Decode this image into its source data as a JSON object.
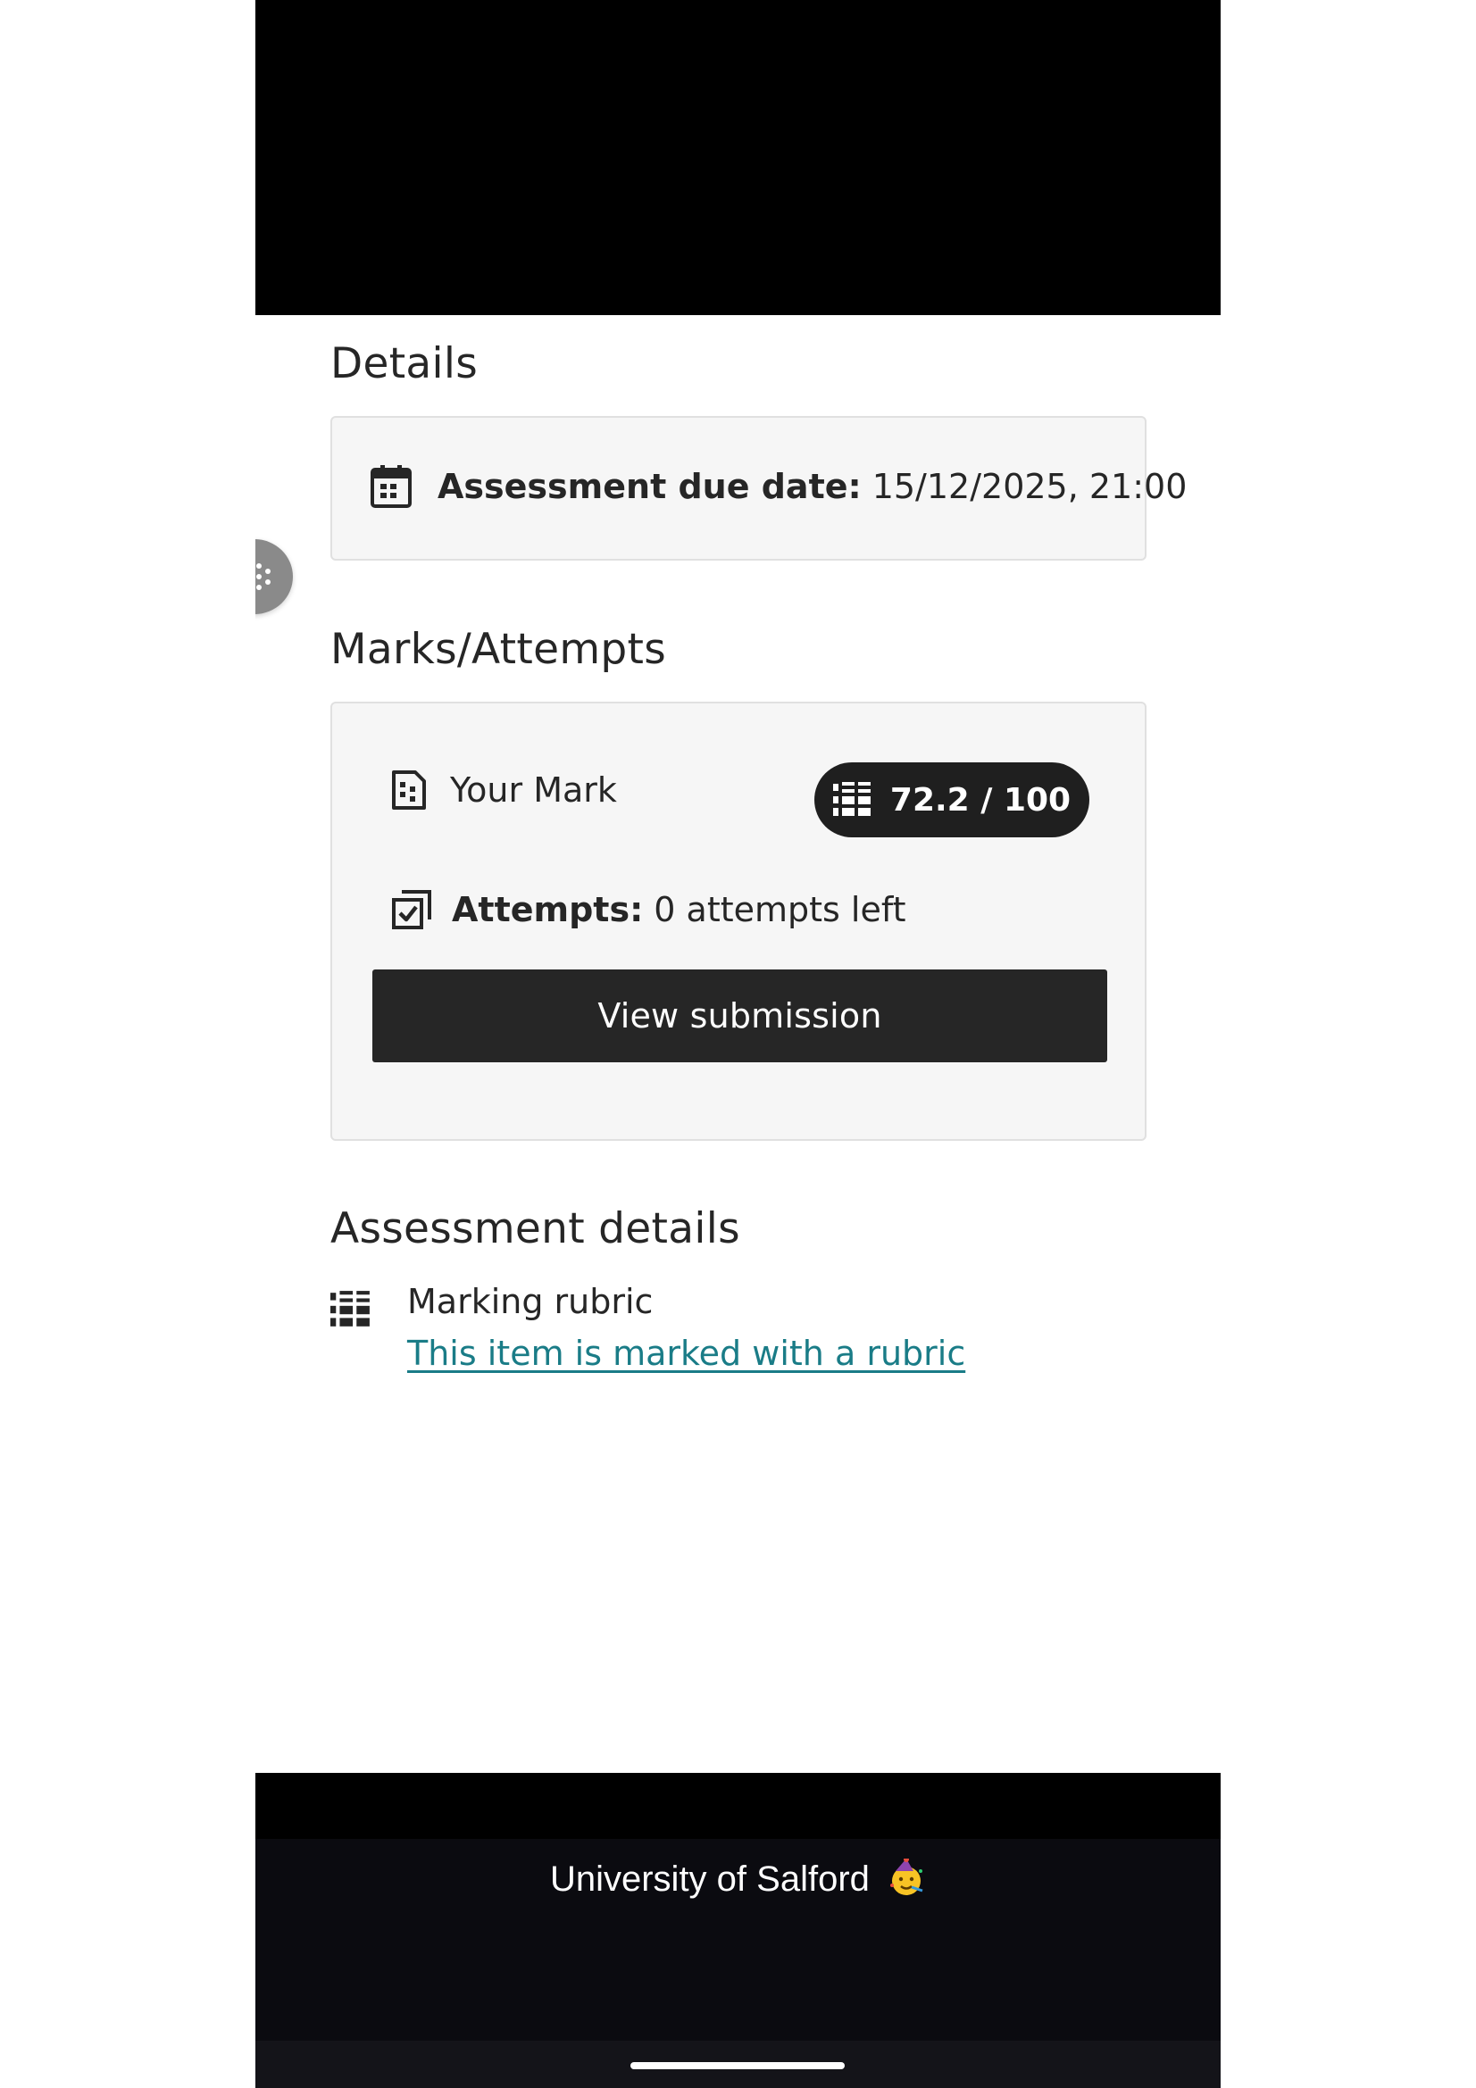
{
  "details": {
    "heading": "Details",
    "due_label": "Assessment due date:",
    "due_value": "15/12/2025, 21:00"
  },
  "marks": {
    "heading": "Marks/Attempts",
    "your_mark_label": "Your Mark",
    "mark_value": "72.2 / 100",
    "attempts_label": "Attempts:",
    "attempts_value": "0 attempts left",
    "view_submission_label": "View submission"
  },
  "assessment_details": {
    "heading": "Assessment details",
    "rubric_title": "Marking rubric",
    "rubric_link": "This item is marked with a rubric"
  },
  "footer": {
    "institution": "University of Salford"
  },
  "colors": {
    "link": "#1a7c87",
    "dark_button": "#262626",
    "card_background": "#f6f6f6"
  },
  "icons": {
    "due_date": "calendar-icon",
    "mark": "grade-document-icon",
    "mark_pill": "rubric-grid-icon",
    "attempts": "attempts-checkbox-icon",
    "rubric": "rubric-grid-icon",
    "footer": "party-face-emoji-icon",
    "side_handle": "spinner-icon"
  }
}
